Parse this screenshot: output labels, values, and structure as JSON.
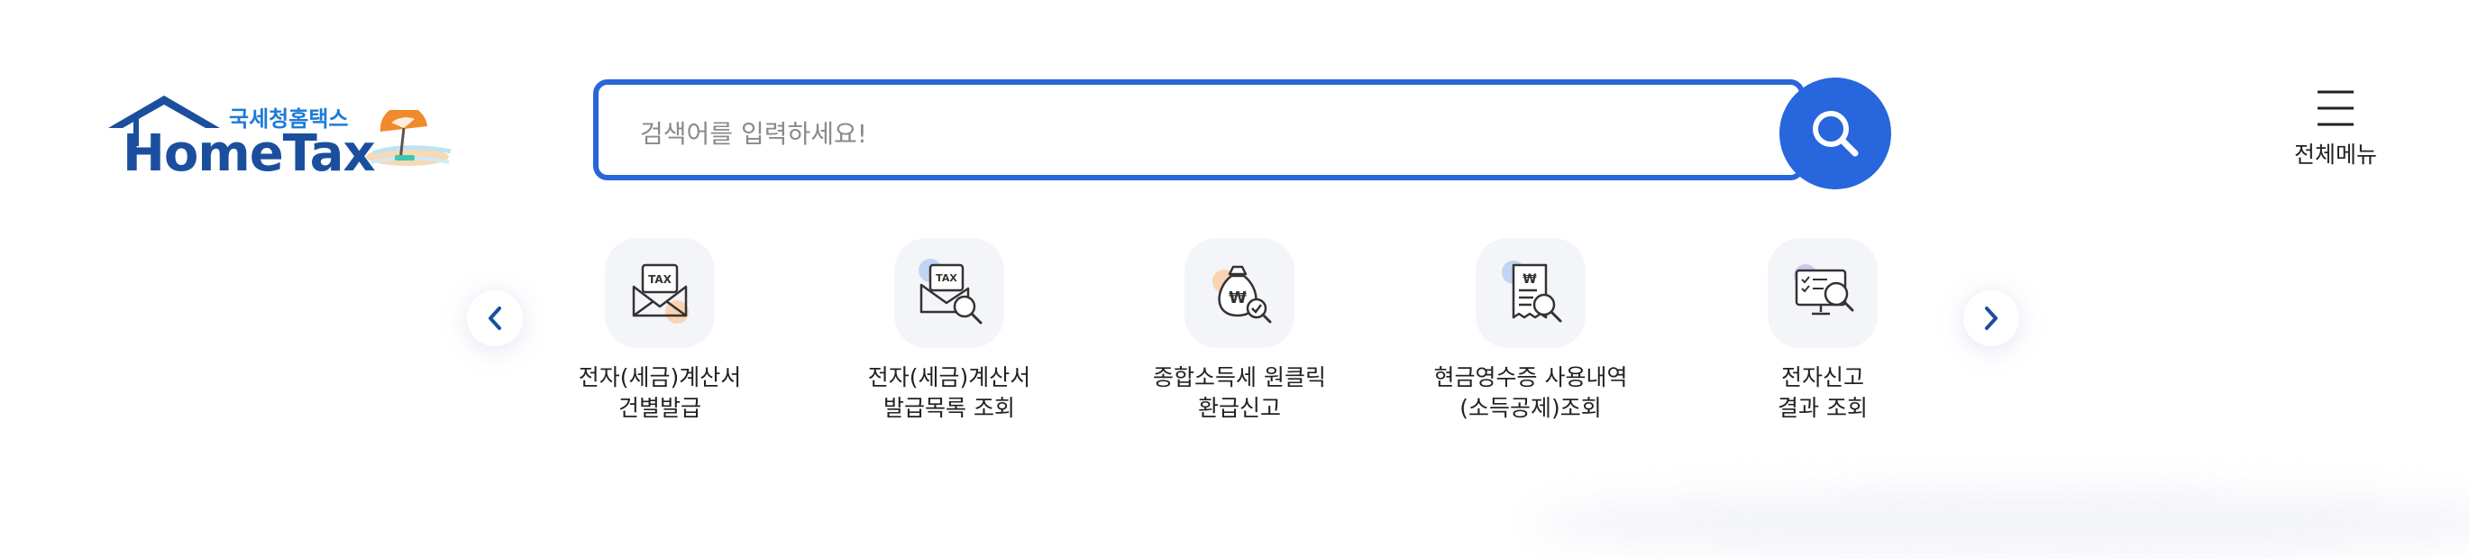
{
  "logo": {
    "korean_name": "국세청홈택스",
    "brand": "HomeTax",
    "colors": {
      "house": "#1b4f9e",
      "korean": "#1c7bd8"
    }
  },
  "search": {
    "placeholder": "검색어를 입력하세요!",
    "value": "",
    "button_icon": "search-icon",
    "accent_color": "#2766dc"
  },
  "menu": {
    "label": "전체메뉴",
    "icon": "hamburger-menu-icon"
  },
  "carousel": {
    "prev_icon": "chevron-left-icon",
    "next_icon": "chevron-right-icon",
    "items": [
      {
        "line1": "전자(세금)계산서",
        "line2": "건별발급",
        "icon": "tax-envelope-icon"
      },
      {
        "line1": "전자(세금)계산서",
        "line2": "발급목록 조회",
        "icon": "tax-envelope-search-icon"
      },
      {
        "line1": "종합소득세 원클릭",
        "line2": "환급신고",
        "icon": "money-bag-icon"
      },
      {
        "line1": "현금영수증 사용내역",
        "line2": "(소득공제)조회",
        "icon": "receipt-search-icon"
      },
      {
        "line1": "전자신고",
        "line2": "결과 조회",
        "icon": "monitor-search-icon"
      }
    ]
  }
}
